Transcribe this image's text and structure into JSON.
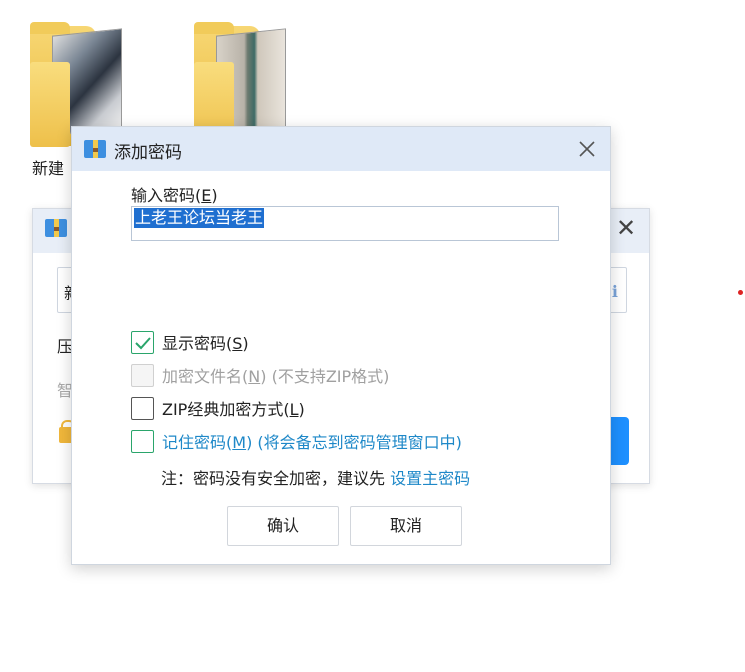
{
  "desktop": {
    "folder_label": "新建"
  },
  "background_window": {
    "input_text": "新",
    "line1": "压",
    "line2": "智"
  },
  "dialog": {
    "title": "添加密码",
    "field_label": "输入密码",
    "field_label_key": "E",
    "password_value": "上老王论坛当老王",
    "options": [
      {
        "label": "显示密码",
        "key": "S",
        "suffix": "",
        "checked": true,
        "disabled": false
      },
      {
        "label": "加密文件名",
        "key": "N",
        "suffix": " (不支持ZIP格式)",
        "checked": false,
        "disabled": true
      },
      {
        "label": "ZIP经典加密方式",
        "key": "L",
        "suffix": "",
        "checked": false,
        "disabled": false
      },
      {
        "label": "记住密码",
        "key": "M",
        "suffix": " (将会备忘到密码管理窗口中)",
        "checked": false,
        "disabled": false
      }
    ],
    "note_prefix": "注：密码没有安全加密，建议先 ",
    "note_link": "设置主密码",
    "ok_label": "确认",
    "cancel_label": "取消"
  },
  "colors": {
    "accent": "#1e88c8",
    "check_green": "#2aa56b",
    "selection": "#1f6fd0",
    "titlebar": "#dfe9f7"
  }
}
